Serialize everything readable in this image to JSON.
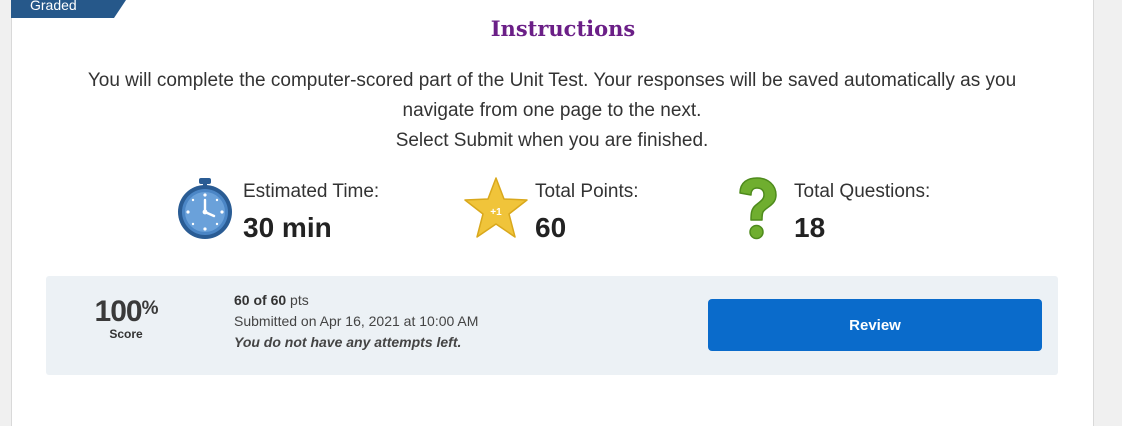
{
  "ribbon": {
    "label": "Graded"
  },
  "title": "Instructions",
  "instructions": {
    "line1": "You will complete the computer-scored part of the Unit Test. Your responses will be saved automatically as you",
    "line2": "navigate from one page to the next.",
    "line3": "Select Submit when you are finished."
  },
  "stats": {
    "time": {
      "label": "Estimated Time:",
      "value": "30 min",
      "icon": "stopwatch-icon"
    },
    "points": {
      "label": "Total Points:",
      "value": "60",
      "icon": "star-icon",
      "icon_text": "+1"
    },
    "questions": {
      "label": "Total Questions:",
      "value": "18",
      "icon": "question-mark-icon"
    }
  },
  "result": {
    "score_value": "100",
    "score_unit": "%",
    "score_label": "Score",
    "points_strong": "60 of 60",
    "points_unit": "pts",
    "submitted": "Submitted on Apr 16, 2021 at 10:00 AM",
    "attempts": "You do not have any attempts left.",
    "review_button": "Review"
  },
  "colors": {
    "title": "#6b1f87",
    "ribbon": "#26588a",
    "button": "#0a6bcb",
    "panel": "#ecf1f5"
  }
}
